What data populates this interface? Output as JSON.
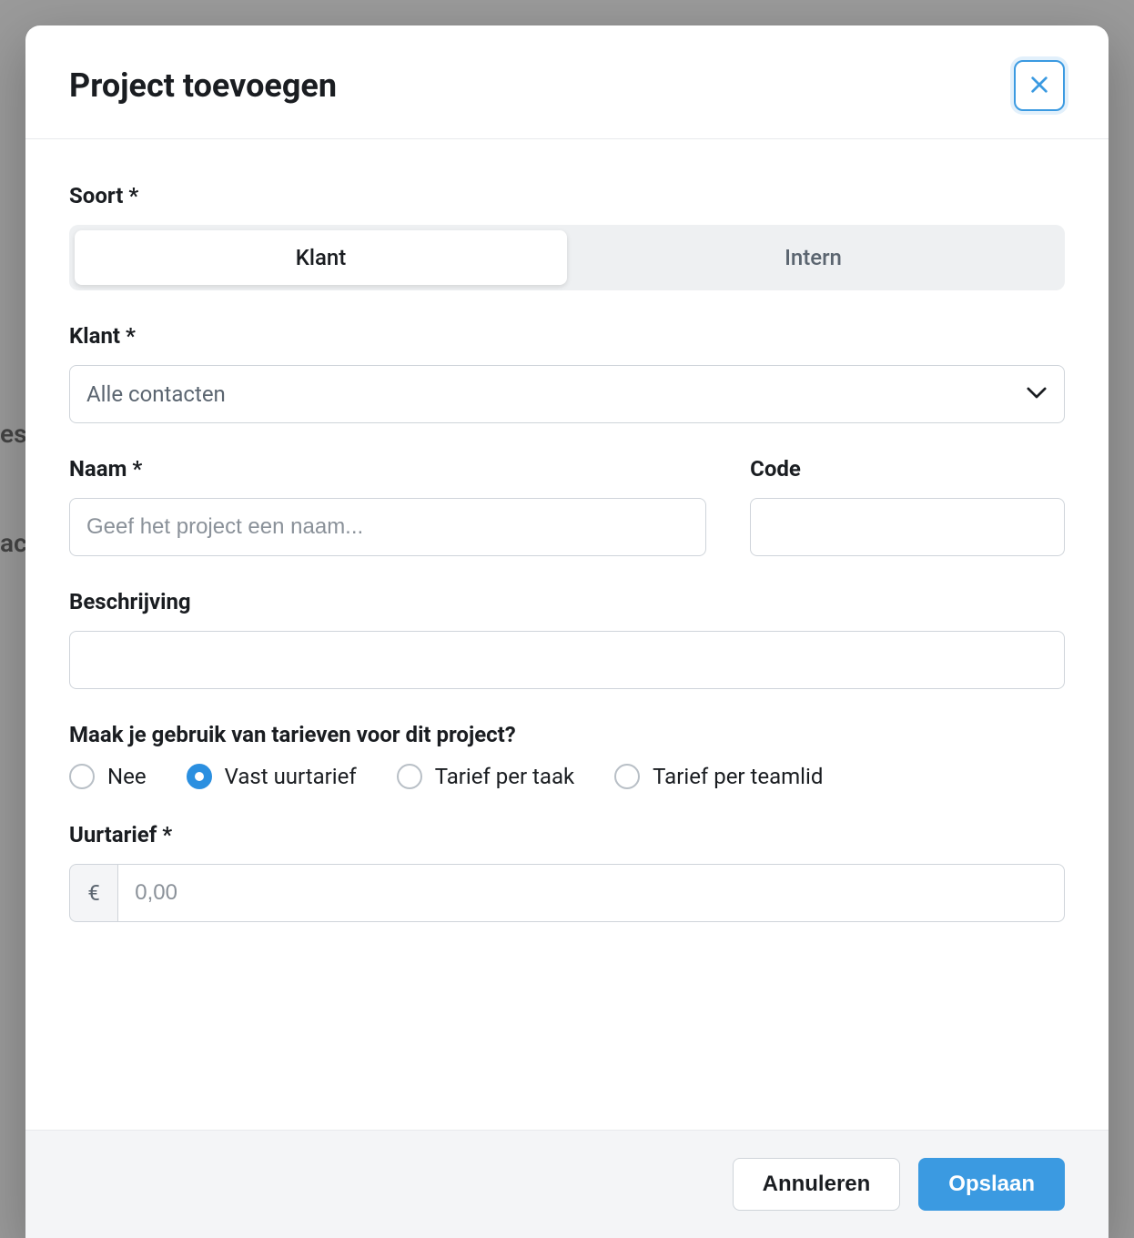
{
  "modal": {
    "title": "Project toevoegen"
  },
  "form": {
    "soort": {
      "label": "Soort *",
      "options": {
        "klant": "Klant",
        "intern": "Intern"
      },
      "selected": "klant"
    },
    "klant": {
      "label": "Klant *",
      "placeholder": "Alle contacten"
    },
    "naam": {
      "label": "Naam *",
      "placeholder": "Geef het project een naam..."
    },
    "code": {
      "label": "Code"
    },
    "beschrijving": {
      "label": "Beschrijving"
    },
    "tarieven": {
      "label": "Maak je gebruik van tarieven voor dit project?",
      "options": {
        "nee": "Nee",
        "vast": "Vast uurtarief",
        "taak": "Tarief per taak",
        "teamlid": "Tarief per teamlid"
      },
      "selected": "vast"
    },
    "uurtarief": {
      "label": "Uurtarief *",
      "currency": "€",
      "placeholder": "0,00"
    }
  },
  "footer": {
    "cancel": "Annuleren",
    "save": "Opslaan"
  }
}
